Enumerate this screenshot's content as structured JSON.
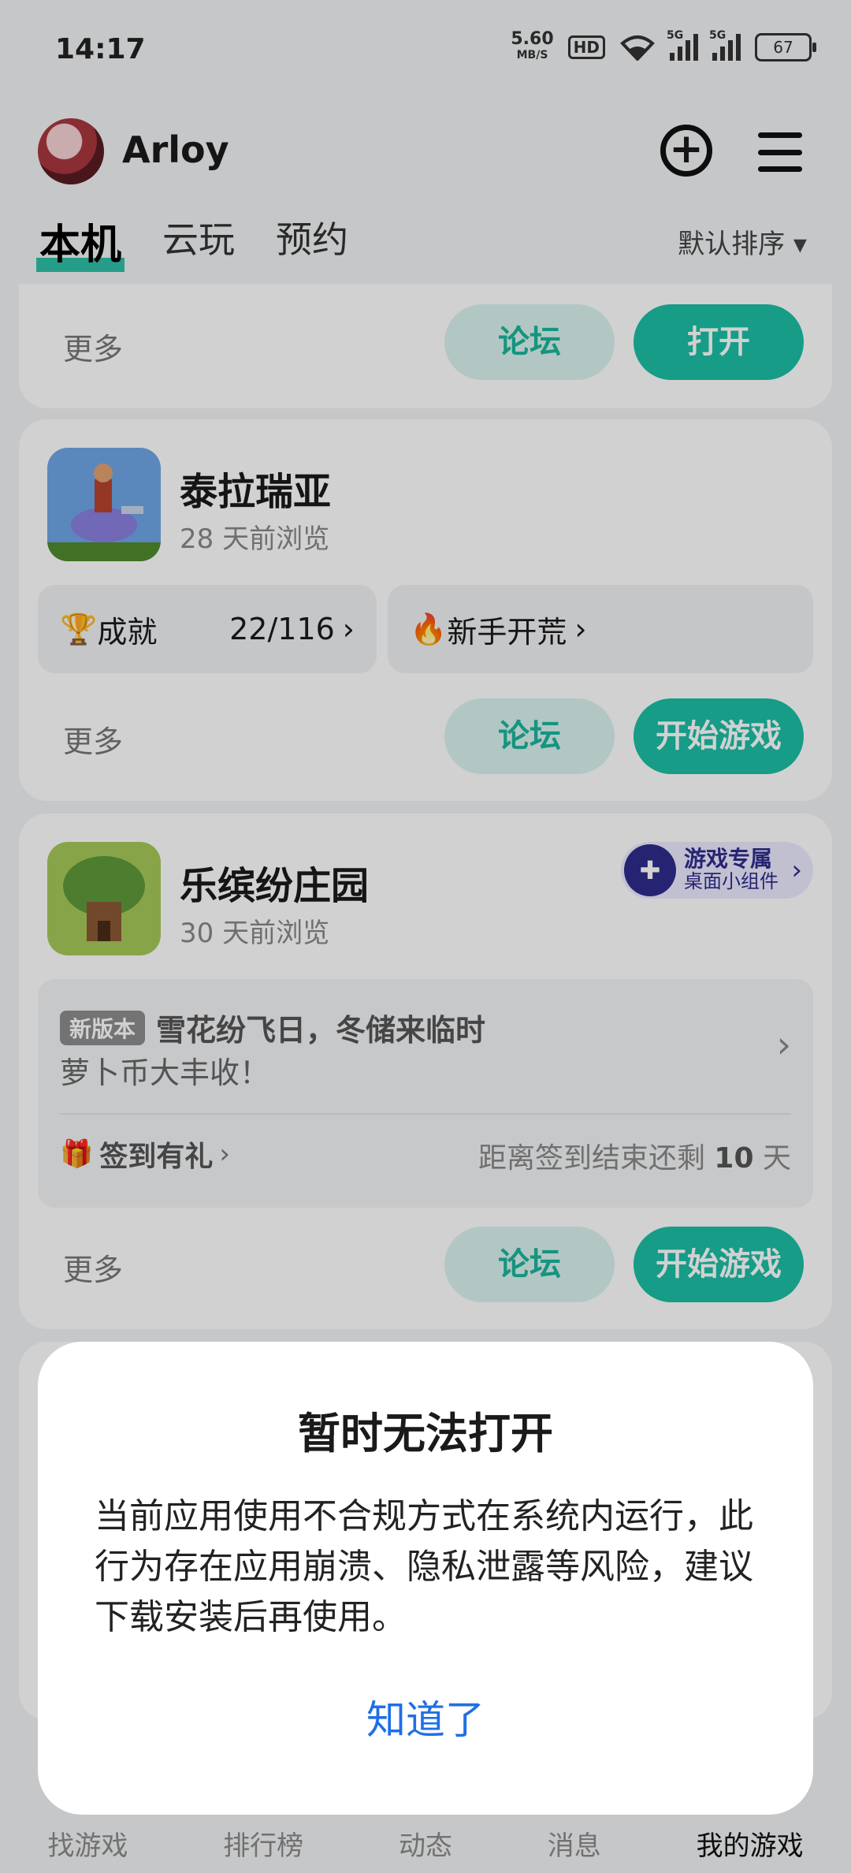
{
  "status_bar": {
    "time": "14:17",
    "speed_value": "5.60",
    "speed_unit": "MB/S",
    "hd": "HD",
    "network1": "5G",
    "network2": "5G",
    "battery": "67"
  },
  "header": {
    "username": "Arloy"
  },
  "tabs": [
    {
      "label": "本机"
    },
    {
      "label": "云玩"
    },
    {
      "label": "预约"
    }
  ],
  "sort_label": "默认排序 ▾",
  "card0": {
    "more": "更多",
    "forum": "论坛",
    "open": "打开"
  },
  "card1": {
    "title": "泰拉瑞亚",
    "subtitle": "28 天前浏览",
    "achievement_label": "成就",
    "achievement_value": "22/116",
    "guide_label": "新手开荒",
    "more": "更多",
    "forum": "论坛",
    "play": "开始游戏"
  },
  "card2": {
    "title": "乐缤纷庄园",
    "subtitle": "30 天前浏览",
    "widget_title": "游戏专属",
    "widget_sub": "桌面小组件",
    "version_badge": "新版本",
    "news_line1": "雪花纷飞日，冬储来临时",
    "news_line2": "萝卜币大丰收！",
    "signin_label": "签到有礼",
    "signin_remaining_prefix": "距离签到结束还剩",
    "signin_remaining_days": "10",
    "signin_remaining_unit": "天",
    "more": "更多",
    "forum": "论坛",
    "play": "开始游戏"
  },
  "dialog": {
    "title": "暂时无法打开",
    "body": "当前应用使用不合规方式在系统内运行，此行为存在应用崩溃、隐私泄露等风险，建议下载安装后再使用。",
    "button": "知道了"
  },
  "bottom_nav": [
    {
      "label": "找游戏"
    },
    {
      "label": "排行榜"
    },
    {
      "label": "动态"
    },
    {
      "label": "消息"
    },
    {
      "label": "我的游戏"
    }
  ],
  "colors": {
    "accent": "#1bbfa5",
    "link_blue": "#1f6fe5"
  }
}
